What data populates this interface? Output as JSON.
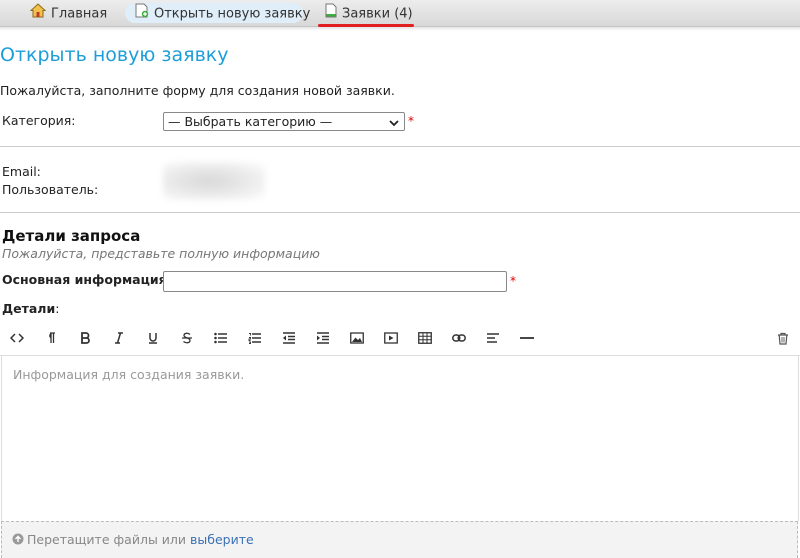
{
  "nav": {
    "home_label": "Главная",
    "open_ticket_label": "Открыть новую заявку",
    "tickets_label": "Заявки (4)"
  },
  "page": {
    "title": "Открыть новую заявку",
    "intro": "Пожалуйста, заполните форму для создания новой заявки."
  },
  "form": {
    "category_label": "Категория:",
    "category_selected": "— Выбрать категорию —",
    "required_mark": "*",
    "email_label": "Email:",
    "user_label": "Пользователь:"
  },
  "details": {
    "title": "Детали запроса",
    "subtitle": "Пожалуйста, представьте полную информацию",
    "subject_label": "Основная информация:",
    "details_label": "Детали",
    "details_colon": ":"
  },
  "editor": {
    "placeholder": "Информация для создания заявки.",
    "toolbar_icons": [
      "code-icon",
      "paragraph-icon",
      "bold-icon",
      "italic-icon",
      "underline-icon",
      "strikethrough-icon",
      "unordered-list-icon",
      "ordered-list-icon",
      "outdent-icon",
      "indent-icon",
      "image-icon",
      "video-icon",
      "table-icon",
      "link-icon",
      "align-icon",
      "horizontal-rule-icon",
      "trash-icon"
    ]
  },
  "dropzone": {
    "text": "Перетащите файлы или",
    "link": "выберите"
  },
  "colors": {
    "accent": "#1e9ed9",
    "required": "#dd0000",
    "active_tab_underline": "#e02020",
    "link": "#3a70b4"
  }
}
